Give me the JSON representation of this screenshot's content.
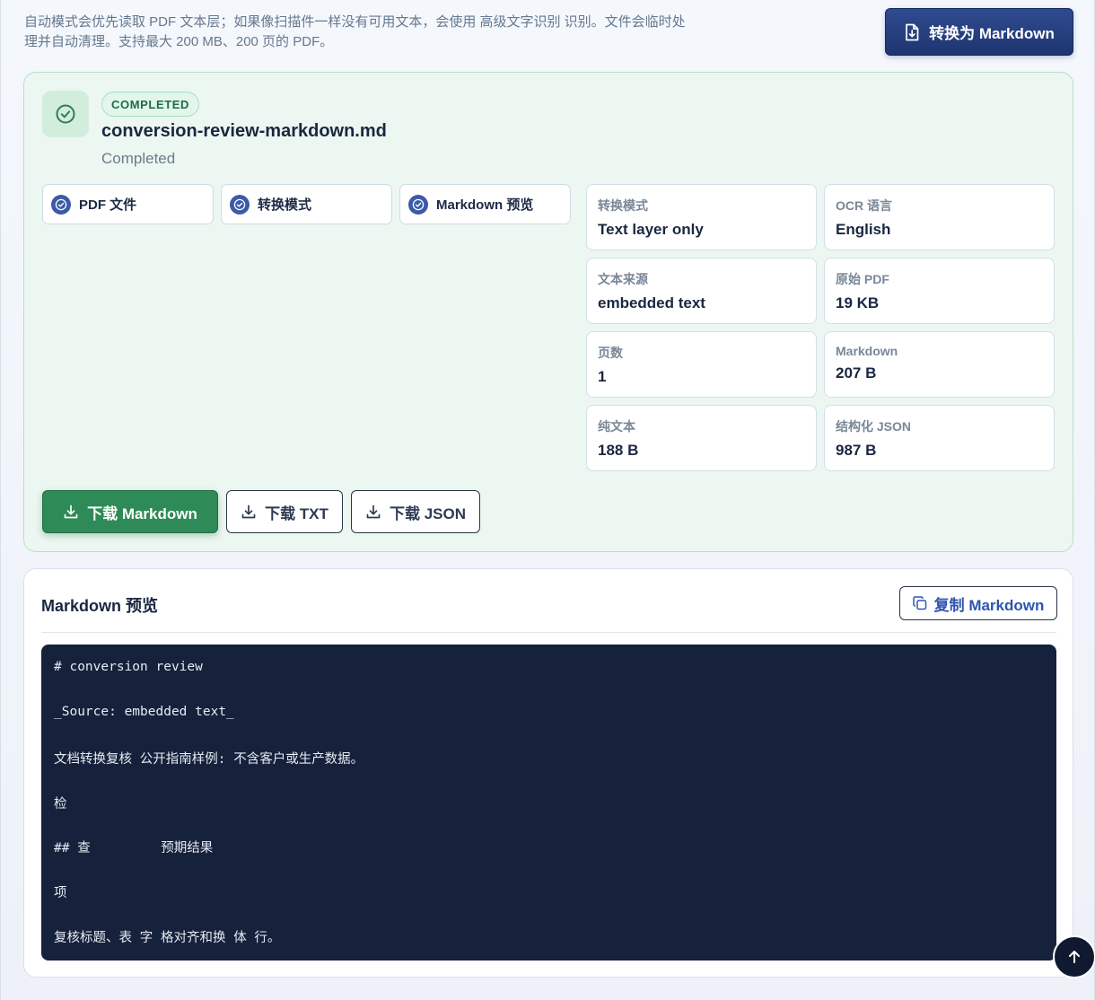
{
  "helper_text": "自动模式会优先读取 PDF 文本层；如果像扫描件一样没有可用文本，会使用 高级文字识别 识别。文件会临时处理并自动清理。支持最大 200 MB、200 页的 PDF。",
  "convert_button": "转换为 Markdown",
  "result": {
    "badge": "COMPLETED",
    "file_name": "conversion-review-markdown.md",
    "status": "Completed",
    "steps": [
      "PDF 文件",
      "转换模式",
      "Markdown 预览"
    ],
    "meta": [
      {
        "label": "转换模式",
        "value": "Text layer only"
      },
      {
        "label": "OCR 语言",
        "value": "English"
      },
      {
        "label": "文本来源",
        "value": "embedded text"
      },
      {
        "label": "原始 PDF",
        "value": "19 KB"
      },
      {
        "label": "页数",
        "value": "1"
      },
      {
        "label": "Markdown",
        "value": "207 B"
      },
      {
        "label": "纯文本",
        "value": "188 B"
      },
      {
        "label": "结构化 JSON",
        "value": "987 B"
      }
    ],
    "downloads": {
      "markdown": "下载 Markdown",
      "txt": "下载 TXT",
      "json": "下载 JSON"
    }
  },
  "preview": {
    "title": "Markdown 预览",
    "copy_button": "复制 Markdown",
    "lines": [
      "# conversion review",
      "_Source: embedded text_",
      "文档转换复核 公开指南样例: 不含客户或生产数据。",
      "检",
      "## 查         预期结果",
      "项",
      "复核标题、表 字 格对齐和换 体 行。"
    ]
  },
  "colors": {
    "primary": "#1e3570",
    "success": "#2e8a56",
    "code_bg": "#16213b"
  }
}
